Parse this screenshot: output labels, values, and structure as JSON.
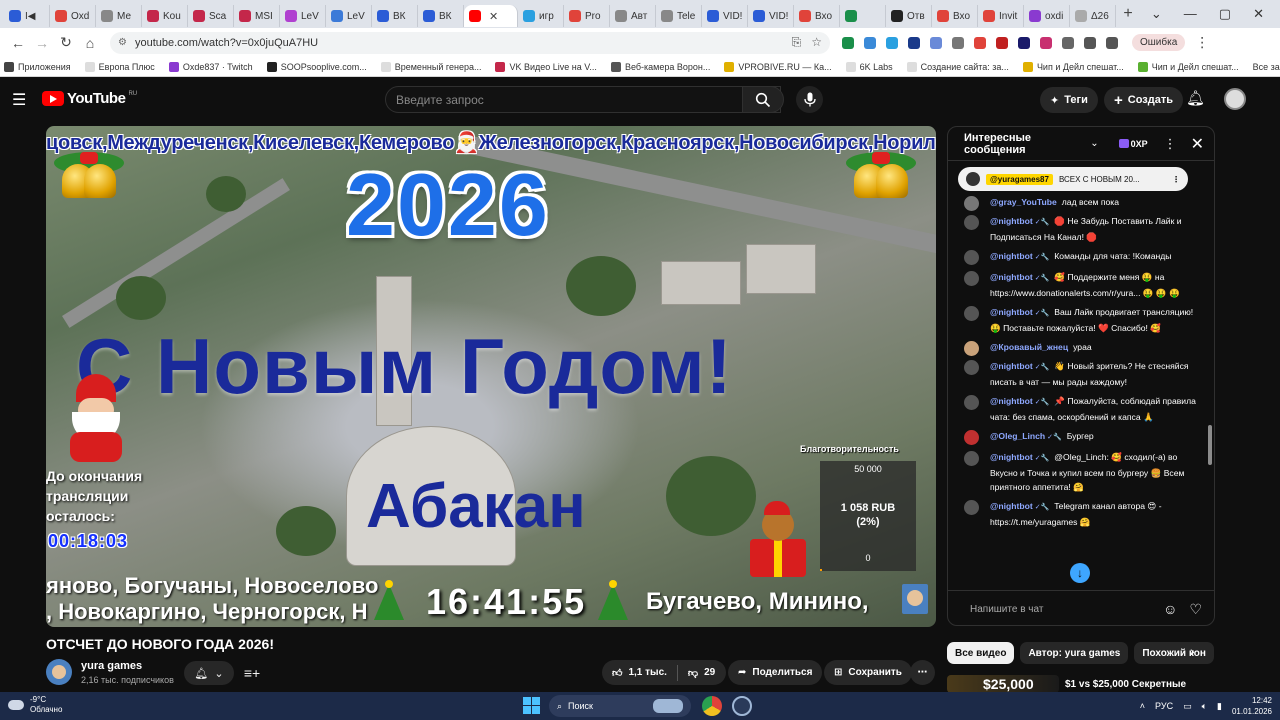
{
  "browser": {
    "tabs": [
      {
        "label": "I◀",
        "color": "#2b5cd6"
      },
      {
        "label": "Oxd",
        "color": "#e0433a"
      },
      {
        "label": "Ме",
        "color": "#888888"
      },
      {
        "label": "Kou",
        "color": "#c4274a"
      },
      {
        "label": "Sca",
        "color": "#c4274a"
      },
      {
        "label": "MSI",
        "color": "#c4274a"
      },
      {
        "label": "LeV",
        "color": "#b040d0"
      },
      {
        "label": "LeV",
        "color": "#3b7ad8"
      },
      {
        "label": "ВК",
        "color": "#2b5cd6"
      },
      {
        "label": "ВК",
        "color": "#2b5cd6"
      },
      {
        "label": "",
        "color": "#ff0000",
        "active": true
      },
      {
        "label": "игр",
        "color": "#2aa0e0"
      },
      {
        "label": "Pro",
        "color": "#e0433a"
      },
      {
        "label": "Авт",
        "color": "#888888"
      },
      {
        "label": "Tele",
        "color": "#888888"
      },
      {
        "label": "VID!",
        "color": "#2b5cd6"
      },
      {
        "label": "VID!",
        "color": "#2b5cd6"
      },
      {
        "label": "Вхо",
        "color": "#e0433a"
      },
      {
        "label": "",
        "color": "#1a8f4a"
      },
      {
        "label": "Отв",
        "color": "#222222"
      },
      {
        "label": "Вхо",
        "color": "#e0433a"
      },
      {
        "label": "Invit",
        "color": "#e0433a"
      },
      {
        "label": "oxdi",
        "color": "#8a3ad0"
      },
      {
        "label": "Δ26",
        "color": "#aaaaaa"
      }
    ],
    "new_tab": "+",
    "window_controls": [
      "⌄",
      "—",
      "▢",
      "✕"
    ],
    "url": "youtube.com/watch?v=0x0juQuA7HU",
    "error_label": "Ошибка",
    "bookmarks": [
      {
        "label": "Приложения",
        "color": "#444444"
      },
      {
        "label": "Европа Плюс",
        "color": "#dddddd"
      },
      {
        "label": "Oxde837 · Twitch",
        "color": "#8a3ad0"
      },
      {
        "label": "SOOPsooplive.com...",
        "color": "#222222"
      },
      {
        "label": "Временный генера...",
        "color": "#dddddd"
      },
      {
        "label": "VK Видео Live на V...",
        "color": "#c4274a"
      },
      {
        "label": "Веб-камера Ворон...",
        "color": "#555555"
      },
      {
        "label": "VPROBIVE.RU — Ка...",
        "color": "#e0b000"
      },
      {
        "label": "6K Labs",
        "color": "#dddddd"
      },
      {
        "label": "Создание сайта: за...",
        "color": "#dddddd"
      },
      {
        "label": "Чип и Дейл спешат...",
        "color": "#e0b000"
      },
      {
        "label": "Чип и Дейл спешат...",
        "color": "#5ab030"
      }
    ],
    "all_bookmarks": "Все закладки"
  },
  "header": {
    "logo_text": "YouTube",
    "logo_region": "RU",
    "search_placeholder": "Введите запрос",
    "tags_label": "Теги",
    "create_label": "Создать"
  },
  "video": {
    "cities_top": "цовск,Междуреченск,Киселевск,Кемерово🎅Железногорск,Красноярск,Новосибирск,Норильск",
    "year": "2026",
    "greeting": "С Новым Годом!",
    "city": "Абакан",
    "countdown_label": "До окончания\nтрансляции\nосталось:",
    "countdown": "00:18:03",
    "cities_bottom_1": "яново, Богучаны, Новоселово",
    "cities_bottom_2": ", Новокаргино, Черногорск, Н",
    "clock": "16:41:55",
    "cities_bottom_3": "Бугачево, Минино,",
    "donation": {
      "title": "Благотворительность",
      "goal": "50 000",
      "amount": "1 058 RUB",
      "percent": "(2%)",
      "min": "0",
      "progress": 0.02
    }
  },
  "below_video": {
    "title": "ОТСЧЕТ ДО НОВОГО ГОДА 2026!",
    "channel": "yura games",
    "subscribers": "2,16 тыс. подписчиков",
    "likes": "1,1 тыс.",
    "dislikes": "29",
    "share_label": "Поделиться",
    "save_label": "Сохранить"
  },
  "chat": {
    "title": "Интересные сообщения",
    "xp": "0XP",
    "pinned_author": "@yuragames87",
    "pinned_text": "ВСЕХ С НОВЫМ 20...",
    "messages": [
      {
        "author": "@gray_YouTube",
        "text": "лад всем пока",
        "mod": false,
        "avatar": "#777777"
      },
      {
        "author": "@nightbot",
        "text": "🛑 Не Забудь Поставить Лайк и Подписаться На Канал! 🛑",
        "mod": true,
        "avatar": "#555555"
      },
      {
        "author": "@nightbot",
        "text": "Команды для чата: !Команды",
        "mod": true,
        "avatar": "#555555"
      },
      {
        "author": "@nightbot",
        "text": "🥰 Поддержите меня 🤑 на https://www.donationalerts.com/r/yura... 🤑 🤑 🤑",
        "mod": true,
        "avatar": "#555555"
      },
      {
        "author": "@nightbot",
        "text": "Ваш Лайк продвигает трансляцию! 🤑 Поставьте пожалуйста! ❤️ Спасибо! 🥰",
        "mod": true,
        "avatar": "#555555"
      },
      {
        "author": "@Кровавый_жнец",
        "text": "ураа",
        "mod": false,
        "avatar": "#c9a27a"
      },
      {
        "author": "@nightbot",
        "text": "👋 Новый зритель? Не стесняйся писать в чат — мы рады каждому!",
        "mod": true,
        "avatar": "#555555"
      },
      {
        "author": "@nightbot",
        "text": "📌 Пожалуйста, соблюдай правила чата: без спама, оскорблений и капса 🙏",
        "mod": true,
        "avatar": "#555555"
      },
      {
        "author": "@Oleg_Linch",
        "text": "Бургер",
        "mod": true,
        "avatar": "#c03030"
      },
      {
        "author": "@nightbot",
        "text": "@Oleg_Linch: 🥰 сходил(-а) во Вкусно и Точка и купил всем по бургеру 🍔 Всем приятного аппетита! 🤗",
        "mod": true,
        "avatar": "#555555"
      },
      {
        "author": "@nightbot",
        "text": "Telegram канал автора 😍 - https://t.me/yuragames 🤗",
        "mod": true,
        "avatar": "#555555"
      }
    ],
    "input_placeholder": "Напишите в чат"
  },
  "related": {
    "chips": [
      {
        "label": "Все видео",
        "active": true
      },
      {
        "label": "Автор: yura games",
        "active": false
      },
      {
        "label": "Похожий кон",
        "active": false
      }
    ],
    "video_thumb_text": "$25,000",
    "video_title": "$1 vs $25,000 Секретные"
  },
  "taskbar": {
    "temp": "-9°C",
    "weather": "Облачно",
    "search_label": "Поиск",
    "lang": "РУС",
    "time": "12:42",
    "date": "01.01.2026"
  }
}
